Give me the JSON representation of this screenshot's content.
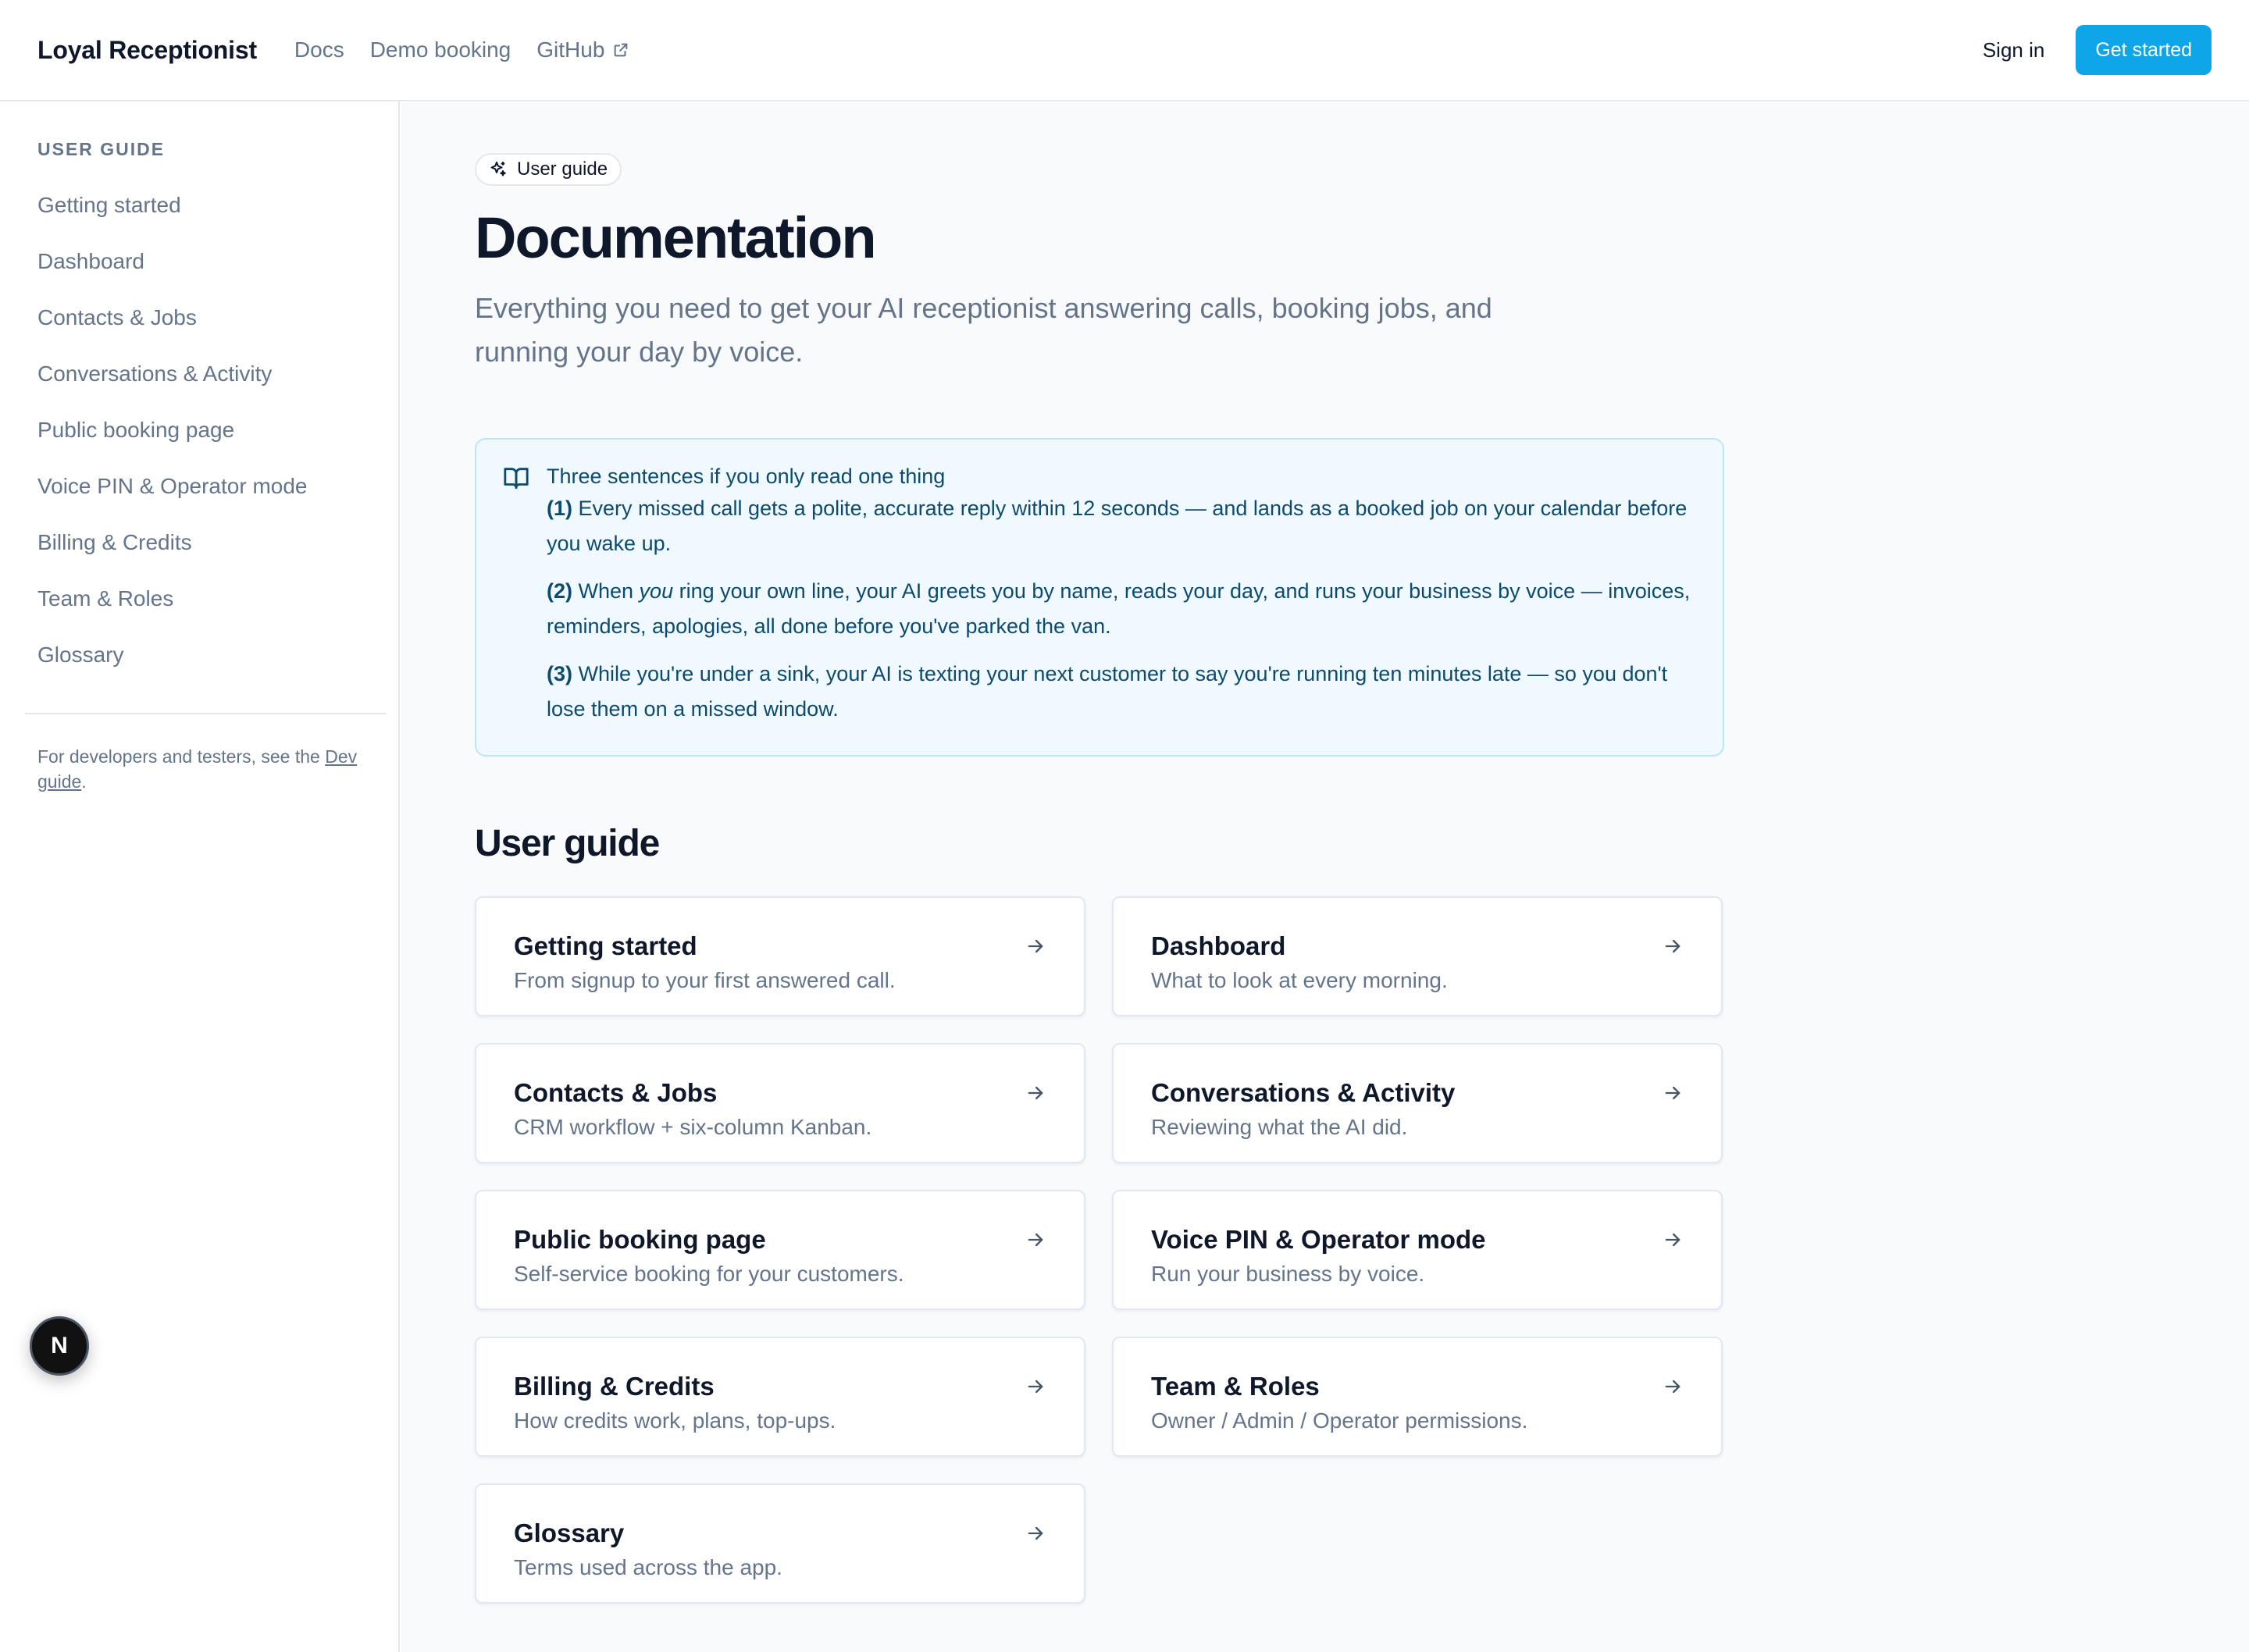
{
  "header": {
    "brand": "Loyal Receptionist",
    "nav": [
      {
        "label": "Docs"
      },
      {
        "label": "Demo booking"
      },
      {
        "label": "GitHub",
        "icon": "external-link-icon"
      }
    ],
    "signin": "Sign in",
    "cta": "Get started",
    "accent_color": "#0ea5e9"
  },
  "sidebar": {
    "heading": "USER GUIDE",
    "items": [
      {
        "label": "Getting started"
      },
      {
        "label": "Dashboard"
      },
      {
        "label": "Contacts & Jobs"
      },
      {
        "label": "Conversations & Activity"
      },
      {
        "label": "Public booking page"
      },
      {
        "label": "Voice PIN & Operator mode"
      },
      {
        "label": "Billing & Credits"
      },
      {
        "label": "Team & Roles"
      },
      {
        "label": "Glossary"
      }
    ],
    "note_prefix": "For developers and testers, see the ",
    "note_link": "Dev guide",
    "note_suffix": "."
  },
  "badge": {
    "letter": "N"
  },
  "main": {
    "pill": "User guide",
    "title": "Documentation",
    "lead": "Everything you need to get your AI receptionist answering calls, booking jobs, and running your day by voice.",
    "callout": {
      "title": "Three sentences if you only read one thing",
      "items": [
        {
          "num": "(1)",
          "before": " Every missed call gets a polite, accurate reply within 12 seconds — and lands as a booked job on your calendar before you wake up.",
          "em": "",
          "after": ""
        },
        {
          "num": "(2)",
          "before": " When ",
          "em": "you",
          "after": " ring your own line, your AI greets you by name, reads your day, and runs your business by voice — invoices, reminders, apologies, all done before you've parked the van."
        },
        {
          "num": "(3)",
          "before": " While you're under a sink, your AI is texting your next customer to say you're running ten minutes late — so you don't lose them on a missed window.",
          "em": "",
          "after": ""
        }
      ]
    },
    "section_title": "User guide",
    "cards": [
      {
        "title": "Getting started",
        "desc": "From signup to your first answered call."
      },
      {
        "title": "Dashboard",
        "desc": "What to look at every morning."
      },
      {
        "title": "Contacts & Jobs",
        "desc": "CRM workflow + six-column Kanban."
      },
      {
        "title": "Conversations & Activity",
        "desc": "Reviewing what the AI did."
      },
      {
        "title": "Public booking page",
        "desc": "Self-service booking for your customers."
      },
      {
        "title": "Voice PIN & Operator mode",
        "desc": "Run your business by voice."
      },
      {
        "title": "Billing & Credits",
        "desc": "How credits work, plans, top-ups."
      },
      {
        "title": "Team & Roles",
        "desc": "Owner / Admin / Operator permissions."
      },
      {
        "title": "Glossary",
        "desc": "Terms used across the app."
      }
    ]
  }
}
